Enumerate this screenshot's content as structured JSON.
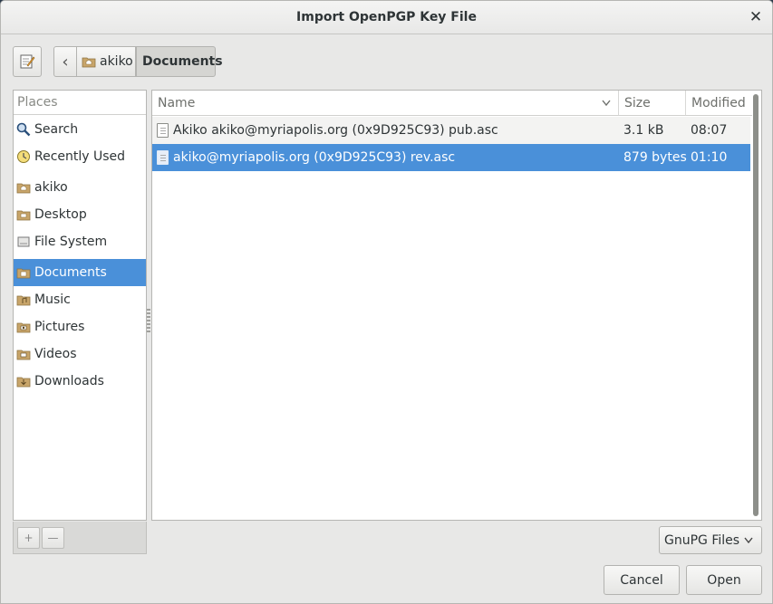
{
  "window": {
    "title": "Import OpenPGP Key File",
    "close_glyph": "✕"
  },
  "pathbar": {
    "edit_icon": "text-edit-icon",
    "back_glyph": "‹",
    "segments": [
      {
        "label": "akiko",
        "icon": "home-folder-icon"
      },
      {
        "label": "Documents"
      }
    ]
  },
  "sidebar": {
    "header": "Places",
    "items": [
      {
        "label": "Search",
        "icon": "search-icon"
      },
      {
        "label": "Recently Used",
        "icon": "recent-icon"
      },
      {
        "label": "akiko",
        "icon": "home-folder-icon"
      },
      {
        "label": "Desktop",
        "icon": "desktop-folder-icon"
      },
      {
        "label": "File System",
        "icon": "drive-icon"
      },
      {
        "label": "Documents",
        "icon": "documents-folder-icon",
        "selected": true
      },
      {
        "label": "Music",
        "icon": "music-folder-icon"
      },
      {
        "label": "Pictures",
        "icon": "pictures-folder-icon"
      },
      {
        "label": "Videos",
        "icon": "videos-folder-icon"
      },
      {
        "label": "Downloads",
        "icon": "downloads-folder-icon"
      }
    ],
    "add_glyph": "+",
    "remove_glyph": "—"
  },
  "filelist": {
    "columns": {
      "name": "Name",
      "size": "Size",
      "modified": "Modified"
    },
    "rows": [
      {
        "name": "Akiko akiko@myriapolis.org (0x9D925C93) pub.asc",
        "size": "3.1 kB",
        "modified": "08:07"
      },
      {
        "name": "akiko@myriapolis.org (0x9D925C93) rev.asc",
        "size": "879 bytes",
        "modified": "01:10",
        "selected": true
      }
    ]
  },
  "filter": {
    "selected": "GnuPG Files"
  },
  "buttons": {
    "cancel": "Cancel",
    "open": "Open"
  },
  "colors": {
    "accent": "#4a90d9",
    "folder": "#c8a56a"
  }
}
